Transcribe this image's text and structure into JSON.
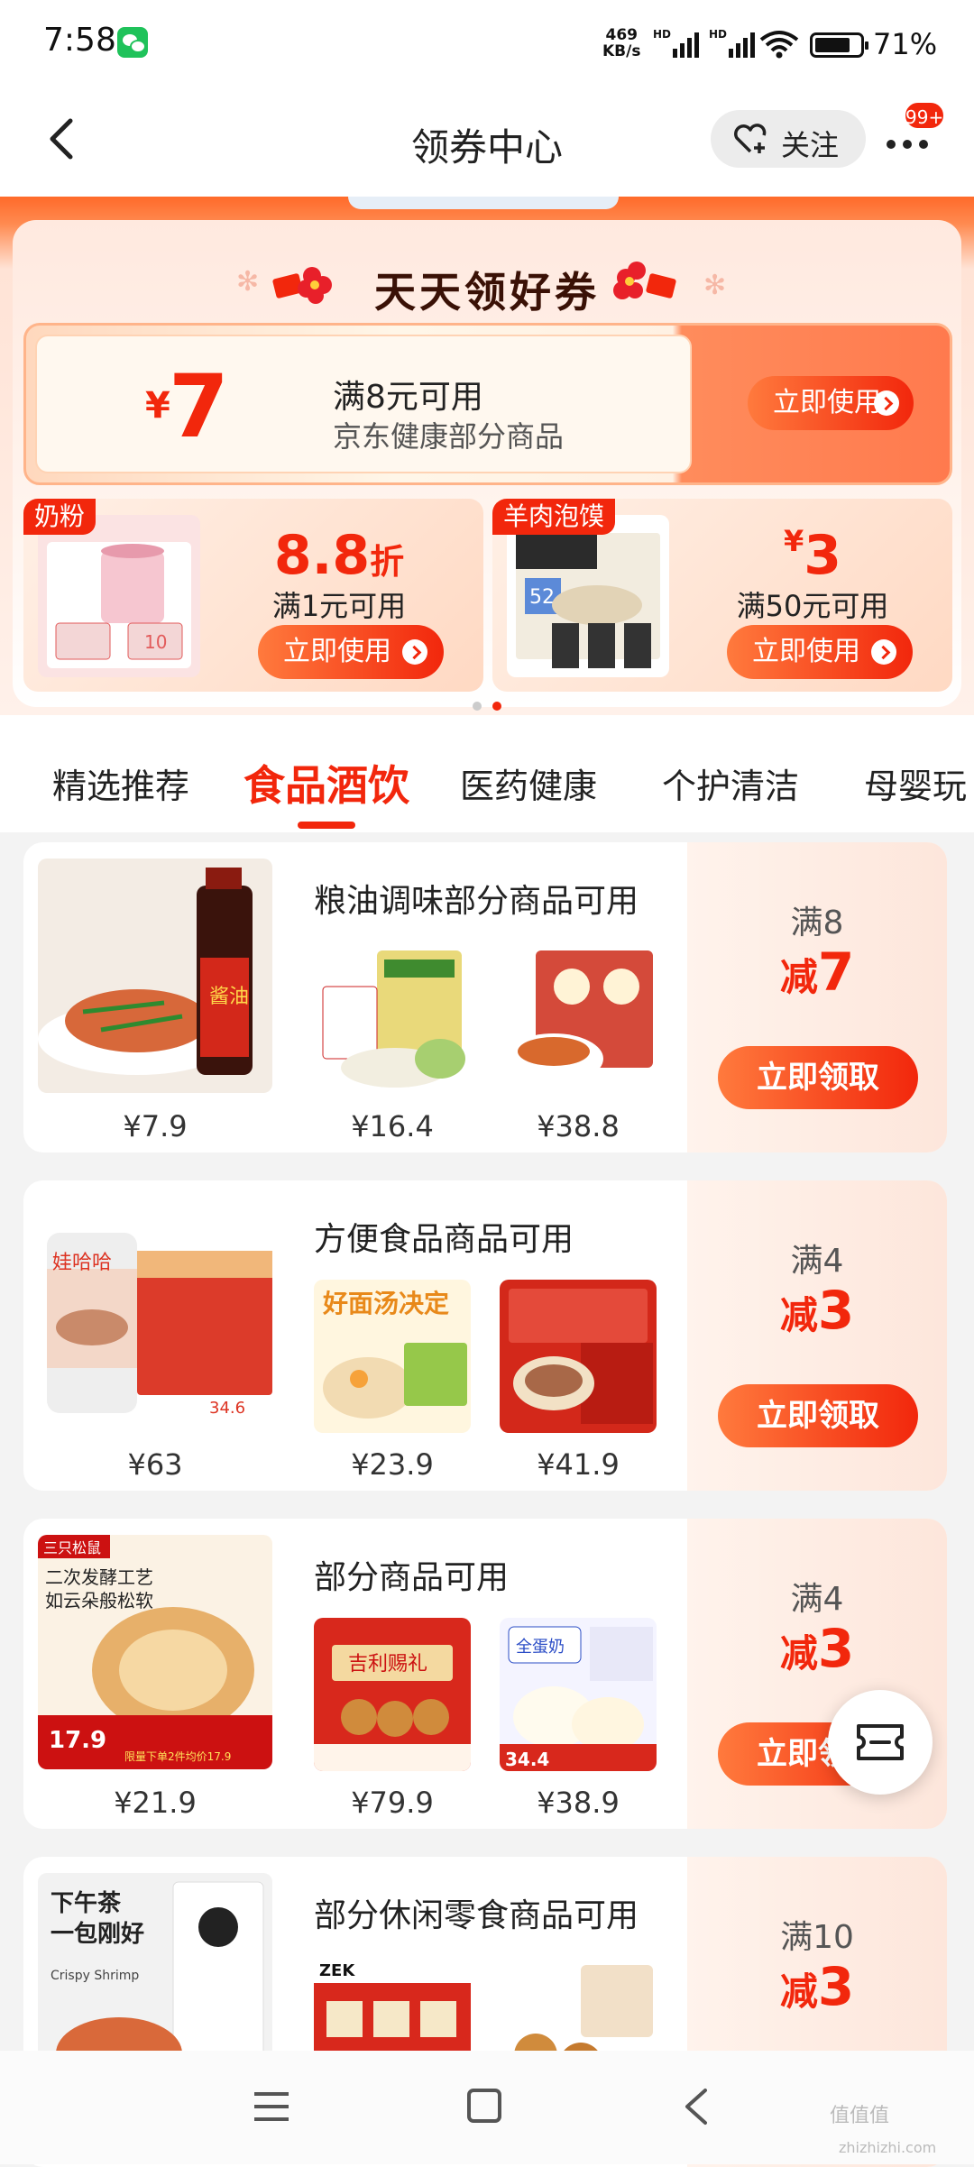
{
  "status_bar": {
    "time": "7:58",
    "net_speed_value": "469",
    "net_speed_unit": "KB/s",
    "signal_1_label": "HD",
    "signal_2_label": "HD",
    "battery": "71%"
  },
  "header": {
    "title": "领券中心",
    "follow_label": "关注",
    "more_badge": "99+"
  },
  "banner": {
    "title": "天天领好券",
    "main_coupon": {
      "currency": "¥",
      "amount": "7",
      "threshold": "满8元可用",
      "scope": "京东健康部分商品",
      "button": "立即使用"
    },
    "small_coupons": [
      {
        "tag": "奶粉",
        "value": "8.8",
        "unit": "折",
        "condition": "满1元可用",
        "button": "立即使用"
      },
      {
        "tag": "羊肉泡馍",
        "currency": "¥",
        "value": "3",
        "condition": "满50元可用",
        "button": "立即使用"
      }
    ]
  },
  "tabs": [
    "精选推荐",
    "食品酒饮",
    "医药健康",
    "个护清洁",
    "母婴玩"
  ],
  "active_tab": "食品酒饮",
  "coupons": [
    {
      "title": "粮油调味部分商品可用",
      "prices": [
        "¥7.9",
        "¥16.4",
        "¥38.8"
      ],
      "threshold": "满8",
      "reduce_label": "减",
      "reduce_amount": "7",
      "button": "立即领取"
    },
    {
      "title": "方便食品商品可用",
      "prices": [
        "¥63",
        "¥23.9",
        "¥41.9"
      ],
      "threshold": "满4",
      "reduce_label": "减",
      "reduce_amount": "3",
      "button": "立即领取"
    },
    {
      "title": "部分商品可用",
      "prices": [
        "¥21.9",
        "¥79.9",
        "¥38.9"
      ],
      "threshold": "满4",
      "reduce_label": "减",
      "reduce_amount": "3",
      "button": "立即领取"
    },
    {
      "title": "部分休闲零食商品可用",
      "prices": [
        "",
        "",
        ""
      ],
      "threshold": "满10",
      "reduce_label": "减",
      "reduce_amount": "3",
      "button": ""
    }
  ],
  "images_text": {
    "soy_sauce": "酱油",
    "noodle_banner": "好面汤决定",
    "brand_squirrel": "三只松鼠",
    "bread_line1": "二次发酵工艺",
    "bread_line2": "如云朵般松软",
    "bread_price": "17.9",
    "bread_note": "限量下单2件均价17.9",
    "gift_box": "吉利赐礼",
    "milk_bun": "全蛋奶",
    "bun_price": "34.4",
    "snack_line1": "下午茶",
    "snack_line2": "一包刚好",
    "snack_en": "Crispy Shrimp",
    "zek_brand": "ZEK",
    "porridge_brand": "娃哈哈",
    "porridge_price": "34.6"
  },
  "watermark": {
    "main": "值值值",
    "sub": "zhizhizhi.com"
  },
  "colors": {
    "accent": "#f2270c",
    "accent_light": "#ff7a3d",
    "banner_bg": "#ffe9df"
  }
}
